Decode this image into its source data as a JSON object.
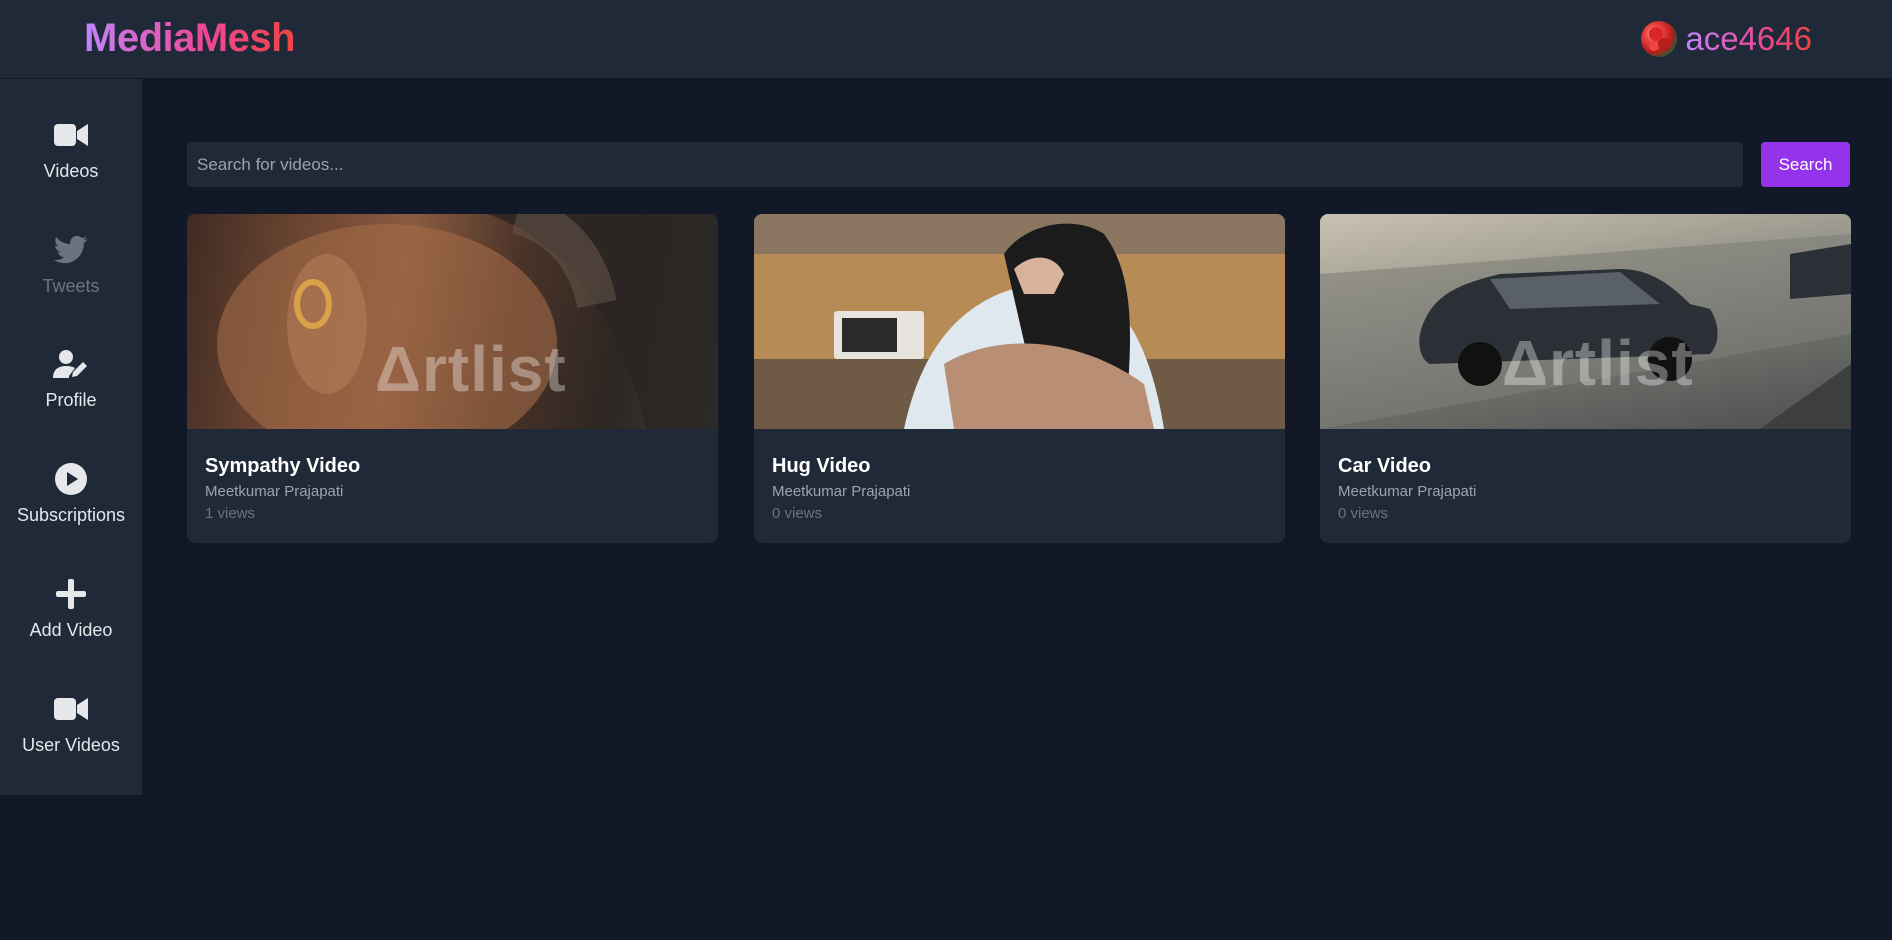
{
  "header": {
    "logo": "MediaMesh",
    "username": "ace4646"
  },
  "sidebar": {
    "items": [
      {
        "label": "Videos",
        "icon": "video-camera-icon"
      },
      {
        "label": "Tweets",
        "icon": "twitter-bird-icon"
      },
      {
        "label": "Profile",
        "icon": "user-edit-icon"
      },
      {
        "label": "Subscriptions",
        "icon": "play-circle-icon"
      },
      {
        "label": "Add Video",
        "icon": "plus-icon"
      },
      {
        "label": "User Videos",
        "icon": "video-camera-icon"
      }
    ]
  },
  "search": {
    "placeholder": "Search for videos...",
    "value": "",
    "button_label": "Search"
  },
  "videos": [
    {
      "title": "Sympathy Video",
      "author": "Meetkumar Prajapati",
      "views": "1 views",
      "watermark": "Δrtlist"
    },
    {
      "title": "Hug Video",
      "author": "Meetkumar Prajapati",
      "views": "0 views",
      "watermark": ""
    },
    {
      "title": "Car Video",
      "author": "Meetkumar Prajapati",
      "views": "0 views",
      "watermark": "Δrtlist"
    }
  ],
  "colors": {
    "background": "#111827",
    "panel": "#1f2937",
    "accent": "#9333ea",
    "logo_gradient_start": "#c084fc",
    "logo_gradient_end": "#ef4444"
  }
}
